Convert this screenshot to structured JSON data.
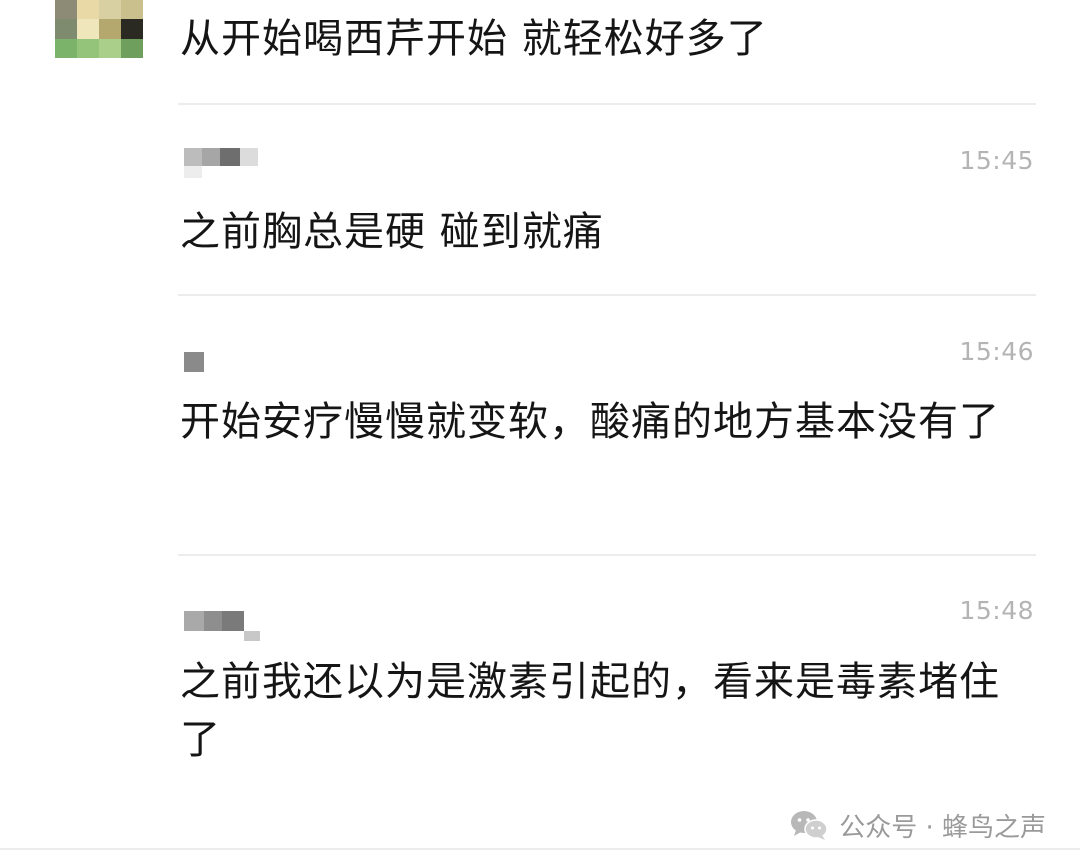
{
  "messages": [
    {
      "text": "从开始喝西芹开始 就轻松好多了",
      "time": ""
    },
    {
      "text": "之前胸总是硬 碰到就痛",
      "time": "15:45"
    },
    {
      "text": "开始安疗慢慢就变软，酸痛的地方基本没有了",
      "time": "15:46"
    },
    {
      "text": "之前我还以为是激素引起的，看来是毒素堵住了",
      "time": "15:48"
    }
  ],
  "watermark": {
    "label": "公众号 · 蜂鸟之声",
    "icon": "wechat-icon"
  },
  "colors": {
    "text": "#151515",
    "time": "#b4b4b4",
    "divider": "#ececec",
    "watermark": "#9a9a9a"
  }
}
